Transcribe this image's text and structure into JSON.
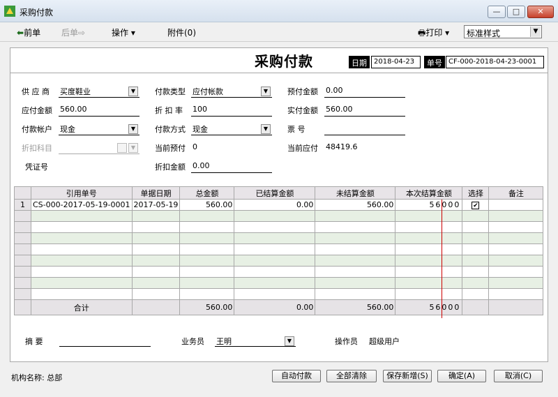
{
  "window": {
    "title": "采购付款"
  },
  "toolbar": {
    "prev_label": "前单",
    "next_label": "后单",
    "operate_label": "操作",
    "attach_label": "附件(0)",
    "print_label": "打印",
    "style_value": "标准样式"
  },
  "doc": {
    "title": "采购付款",
    "date_label": "日期",
    "date_value": "2018-04-23",
    "no_label": "单号",
    "no_value": "CF-000-2018-04-23-0001"
  },
  "form": {
    "supplier_label": "供 应 商",
    "supplier_value": "买度鞋业",
    "pay_type_label": "付款类型",
    "pay_type_value": "应付帐款",
    "prepay_label": "预付金额",
    "prepay_value": "0.00",
    "payable_label": "应付金额",
    "payable_value": "560.00",
    "discount_rate_label": "折 扣 率",
    "discount_rate_value": "100",
    "actual_label": "实付金额",
    "actual_value": "560.00",
    "account_label": "付款帐户",
    "account_value": "现金",
    "method_label": "付款方式",
    "method_value": "现金",
    "ticket_label": "票    号",
    "ticket_value": "",
    "discount_subject_label": "折扣科目",
    "current_prepay_label": "当前预付",
    "current_prepay_value": "0",
    "current_payable_label": "当前应付",
    "current_payable_value": "48419.6",
    "voucher_label": "凭证号",
    "discount_amount_label": "折扣金额",
    "discount_amount_value": "0.00"
  },
  "grid": {
    "columns": [
      "引用单号",
      "单据日期",
      "总金额",
      "已结算金额",
      "未结算金额",
      "本次结算金额",
      "选择",
      "备注"
    ],
    "rows": [
      {
        "index": "1",
        "ref": "CS-000-2017-05-19-0001",
        "date": "2017-05-19",
        "total": "560.00",
        "settled": "0.00",
        "unsettled": "560.00",
        "current": "56000",
        "selected": "✔",
        "note": ""
      }
    ],
    "total_label": "合计",
    "total_total": "560.00",
    "total_settled": "0.00",
    "total_unsettled": "560.00",
    "total_current": "56000"
  },
  "footer": {
    "summary_label": "摘    要",
    "summary_value": "",
    "salesman_label": "业务员",
    "salesman_value": "王明",
    "operator_label": "操作员",
    "operator_value": "超级用户"
  },
  "status": {
    "org_label": "机构名称:",
    "org_value": "总部",
    "auto_pay": "自动付款",
    "clear_all": "全部清除",
    "save_new": "保存新增(S)",
    "confirm": "确定(A)",
    "cancel": "取消(C)"
  },
  "colors": {
    "accent_red": "#cc0000",
    "row_alt": "#e7f0e4",
    "header_bg": "#e8e4e8"
  }
}
